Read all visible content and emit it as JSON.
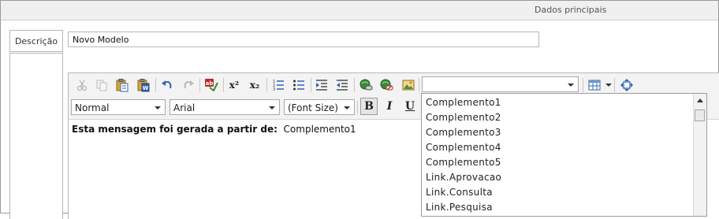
{
  "header": {
    "title": "Dados principais"
  },
  "form": {
    "description_label": "Descrição",
    "name_value": "Novo Modelo"
  },
  "toolbar": {
    "row1_icons": [
      "cut-icon",
      "copy-icon",
      "paste-icon",
      "paste-word-icon",
      "undo-icon",
      "redo-icon",
      "spellcheck-icon",
      "superscript-icon",
      "subscript-icon",
      "ordered-list-icon",
      "unordered-list-icon",
      "indent-icon",
      "outdent-icon",
      "insert-link-icon",
      "remove-link-icon",
      "insert-image-icon",
      "table-icon",
      "fullscreen-icon"
    ],
    "superscript_label": "x²",
    "subscript_label": "x₂",
    "field_select_value": "",
    "paragraph_value": "Normal",
    "font_value": "Arial",
    "font_size_value": "(Font Size)",
    "bold_label": "B",
    "italic_label": "I",
    "underline_label": "U"
  },
  "editor": {
    "message_label": "Esta mensagem foi gerada a partir de:",
    "message_value": "Complemento1"
  },
  "dropdown": {
    "items": [
      "Complemento1",
      "Complemento2",
      "Complemento3",
      "Complemento4",
      "Complemento5",
      "Link.Aprovacao",
      "Link.Consulta",
      "Link.Pesquisa"
    ]
  }
}
